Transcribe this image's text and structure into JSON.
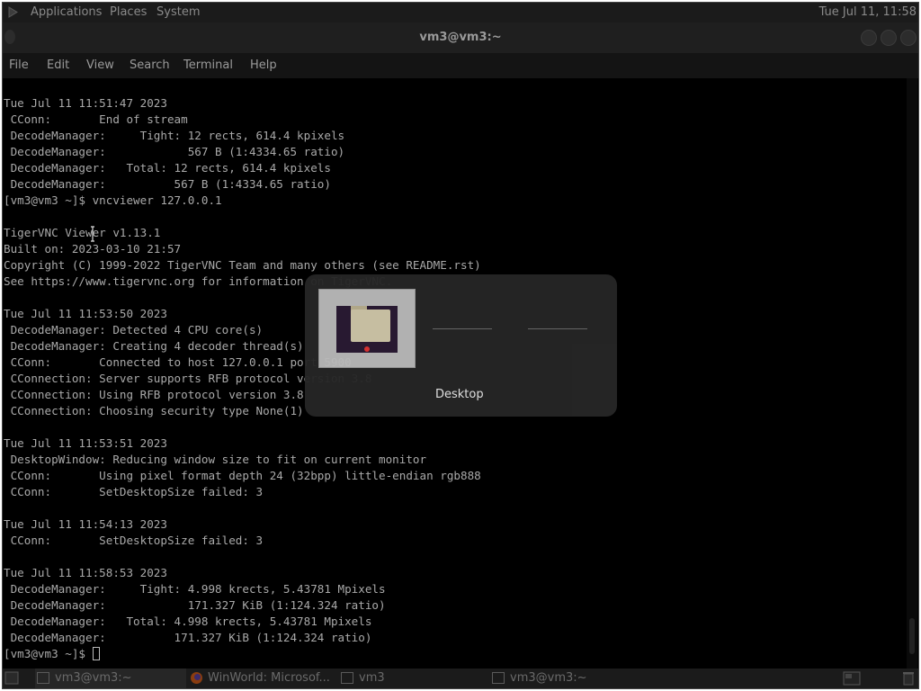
{
  "top_panel": {
    "menus": [
      "Applications",
      "Places",
      "System"
    ],
    "clock": "Tue Jul 11, 11:58"
  },
  "terminal": {
    "title": "vm3@vm3:~",
    "menu": [
      "File",
      "Edit",
      "View",
      "Search",
      "Terminal",
      "Help"
    ],
    "lines": [
      "Tue Jul 11 11:51:47 2023",
      " CConn:       End of stream",
      " DecodeManager:     Tight: 12 rects, 614.4 kpixels",
      " DecodeManager:            567 B (1:4334.65 ratio)",
      " DecodeManager:   Total: 12 rects, 614.4 kpixels",
      " DecodeManager:          567 B (1:4334.65 ratio)",
      "[vm3@vm3 ~]$ vncviewer 127.0.0.1",
      "",
      "TigerVNC Viewer v1.13.1",
      "Built on: 2023-03-10 21:57",
      "Copyright (C) 1999-2022 TigerVNC Team and many others (see README.rst)",
      "See https://www.tigervnc.org for information on TigerVNC.",
      "",
      "Tue Jul 11 11:53:50 2023",
      " DecodeManager: Detected 4 CPU core(s)",
      " DecodeManager: Creating 4 decoder thread(s)",
      " CConn:       Connected to host 127.0.0.1 port 5900",
      " CConnection: Server supports RFB protocol version 3.8",
      " CConnection: Using RFB protocol version 3.8",
      " CConnection: Choosing security type None(1)",
      "",
      "Tue Jul 11 11:53:51 2023",
      " DesktopWindow: Reducing window size to fit on current monitor",
      " CConn:       Using pixel format depth 24 (32bpp) little-endian rgb888",
      " CConn:       SetDesktopSize failed: 3",
      "",
      "Tue Jul 11 11:54:13 2023",
      " CConn:       SetDesktopSize failed: 3",
      "",
      "Tue Jul 11 11:58:53 2023",
      " DecodeManager:     Tight: 4.998 krects, 5.43781 Mpixels",
      " DecodeManager:            171.327 KiB (1:124.324 ratio)",
      " DecodeManager:   Total: 4.998 krects, 5.43781 Mpixels",
      " DecodeManager:          171.327 KiB (1:124.324 ratio)"
    ],
    "prompt": "[vm3@vm3 ~]$ "
  },
  "switcher": {
    "label": "Desktop"
  },
  "taskbar": {
    "items": [
      {
        "label": "vm3@vm3:~",
        "icon": "terminal-icon"
      },
      {
        "label": "WinWorld: Microsof...",
        "icon": "firefox-icon"
      },
      {
        "label": "vm3",
        "icon": "vnc-icon"
      },
      {
        "label": "vm3@vm3:~",
        "icon": "terminal-icon"
      }
    ]
  },
  "colors": {
    "background": "#000000",
    "terminal_text": "#a9a9a9",
    "panel": "#1b1b1b",
    "switcher_bg": "#262626"
  }
}
